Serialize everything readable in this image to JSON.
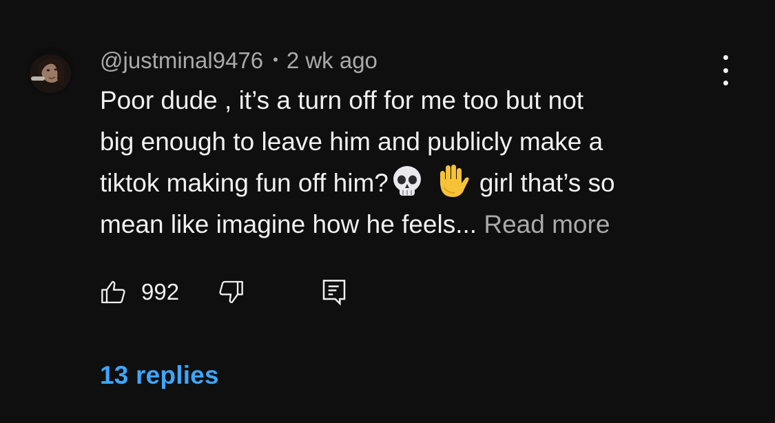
{
  "comment": {
    "author": "@justminal9476",
    "separator": "•",
    "timestamp": "2 wk ago",
    "lines": [
      "Poor dude , it’s a turn off for me too but not",
      "big enough to leave him and publicly make a",
      "tiktok making fun off him?",
      "girl that’s so",
      "mean like imagine how he feels..."
    ],
    "emojis": [
      "skull-emoji",
      "raised-hand-emoji"
    ],
    "read_more_label": "Read more"
  },
  "actions": {
    "like_count": "992",
    "like_icon": "thumbs-up-icon",
    "dislike_icon": "thumbs-down-icon",
    "reply_icon": "reply-comment-icon"
  },
  "replies_label": "13 replies",
  "more_icon": "vertical-ellipsis-icon",
  "colors": {
    "background": "#0f0f0f",
    "text": "#f1f1f1",
    "secondary": "#aaaaaa",
    "link": "#3ea6ff"
  }
}
